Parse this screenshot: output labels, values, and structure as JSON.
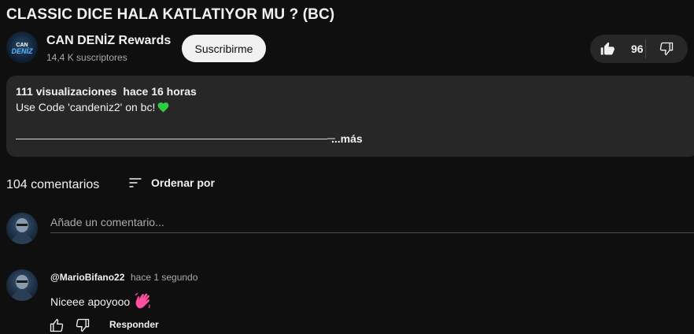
{
  "video": {
    "title": "CLASSIC DICE HALA KATLATIYOR MU ? (BC)"
  },
  "channel": {
    "name": "CAN DENİZ Rewards",
    "subscribers": "14,4 K suscriptores",
    "avatar_text_top": "CAN",
    "avatar_text_bottom": "DENİZ",
    "subscribe_label": "Suscribirme"
  },
  "actions": {
    "like_count": "96",
    "like_icon": "thumbs-up-filled-icon",
    "dislike_icon": "thumbs-down-icon"
  },
  "description": {
    "views": "111 visualizaciones",
    "time": "hace 16 horas",
    "text": "Use Code 'candeniz2' on bc!",
    "emoji": "green-heart",
    "more_label": "...más"
  },
  "comments": {
    "count_label": "104 comentarios",
    "sort_label": "Ordenar por",
    "add_placeholder": "Añade un comentario...",
    "items": [
      {
        "author": "@MarioBifano22",
        "time": "hace 1 segundo",
        "text": "Niceee apoyooo",
        "emoji": "waving-hand",
        "reply_label": "Responder"
      }
    ]
  },
  "colors": {
    "background": "#0f0f0f",
    "surface": "#272727",
    "text": "#f1f1f1",
    "secondary_text": "#aaaaaa",
    "heart": "#2ecc40",
    "wave": "#ff4fa0"
  }
}
